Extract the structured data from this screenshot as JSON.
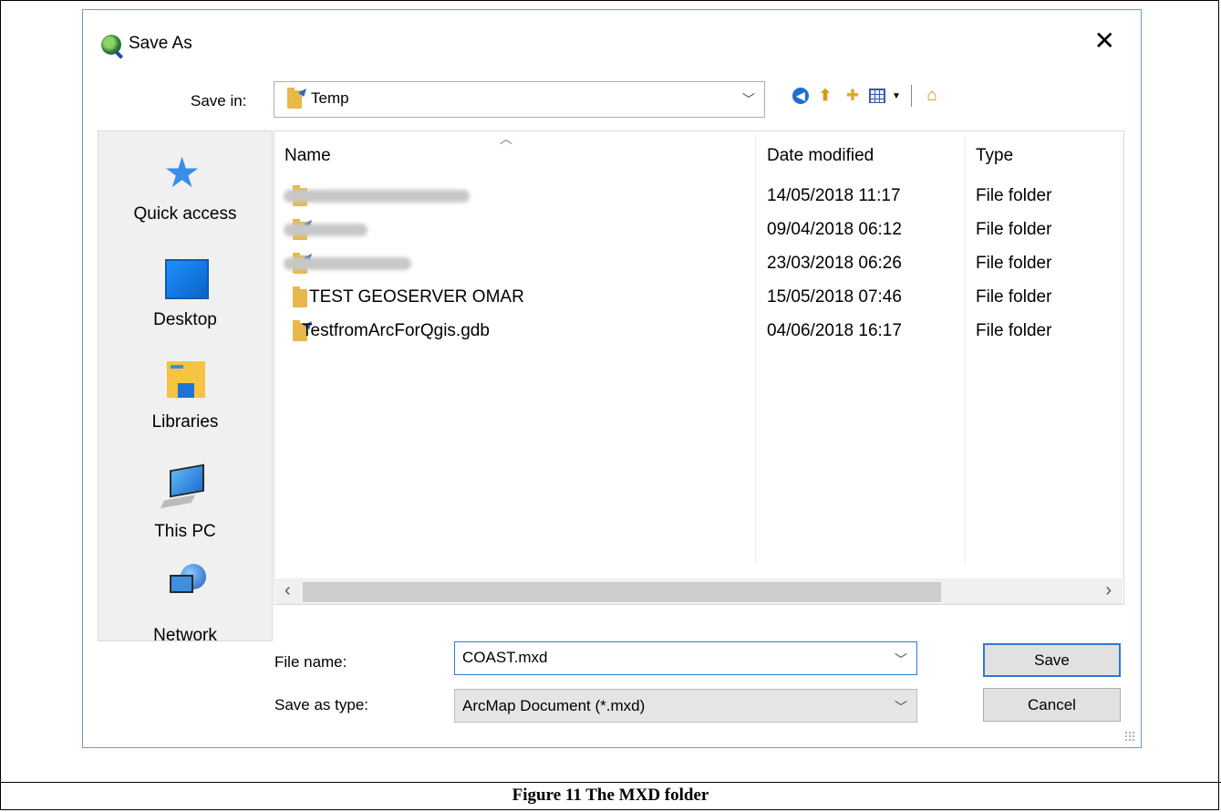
{
  "dialog": {
    "title": "Save As",
    "close_glyph": "✕",
    "app_icon": "qgis-icon"
  },
  "save_in": {
    "label": "Save in:",
    "value": "Temp"
  },
  "toolbar": {
    "icons": [
      "back-icon",
      "up-folder-icon",
      "new-folder-icon",
      "view-menu-icon",
      "home-icon"
    ]
  },
  "places": {
    "items": [
      {
        "label": "Quick access",
        "icon": "star-icon"
      },
      {
        "label": "Desktop",
        "icon": "desktop-icon"
      },
      {
        "label": "Libraries",
        "icon": "libraries-icon"
      },
      {
        "label": "This PC",
        "icon": "computer-icon"
      },
      {
        "label": "Network",
        "icon": "network-icon"
      }
    ]
  },
  "filelist": {
    "columns": {
      "name": "Name",
      "date": "Date modified",
      "type": "Type"
    },
    "rows": [
      {
        "name": "",
        "date": "14/05/2018 11:17",
        "type": "File folder",
        "redacted": true
      },
      {
        "name": "",
        "date": "09/04/2018 06:12",
        "type": "File folder",
        "redacted": true
      },
      {
        "name": "",
        "date": "23/03/2018 06:26",
        "type": "File folder",
        "redacted": true
      },
      {
        "name": "TEST GEOSERVER OMAR",
        "date": "15/05/2018 07:46",
        "type": "File folder"
      },
      {
        "name": "TestfromArcForQgis.gdb",
        "date": "04/06/2018 16:17",
        "type": "File folder"
      }
    ]
  },
  "file_name": {
    "label": "File name:",
    "value": "COAST.mxd"
  },
  "save_as_type": {
    "label": "Save as type:",
    "value": "ArcMap Document (*.mxd)"
  },
  "buttons": {
    "save": "Save",
    "cancel": "Cancel"
  },
  "caption": "Figure 11 The MXD folder"
}
